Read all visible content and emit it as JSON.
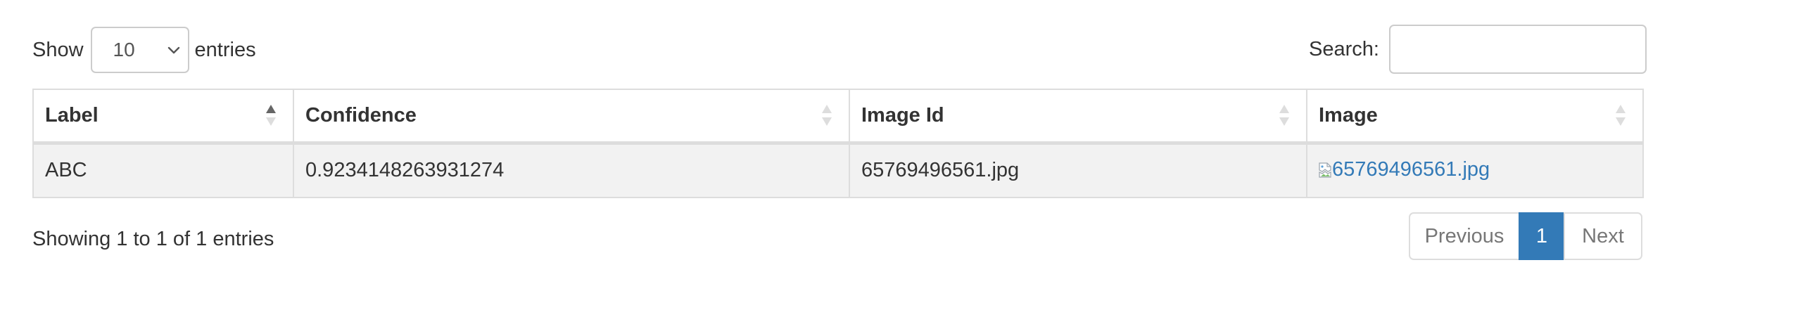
{
  "length_control": {
    "prefix": "Show",
    "selected": "10",
    "suffix": "entries"
  },
  "search": {
    "label": "Search:",
    "value": ""
  },
  "table": {
    "columns": [
      {
        "label": "Label",
        "sort": "ascending"
      },
      {
        "label": "Confidence",
        "sort": "none"
      },
      {
        "label": "Image Id",
        "sort": "none"
      },
      {
        "label": "Image",
        "sort": "none"
      }
    ],
    "rows": [
      {
        "label": "ABC",
        "confidence": "0.9234148263931274",
        "image_id": "65769496561.jpg",
        "image_alt": "65769496561.jpg"
      }
    ]
  },
  "footer": {
    "info": "Showing 1 to 1 of 1 entries",
    "previous_label": "Previous",
    "current_page": "1",
    "next_label": "Next"
  },
  "colors": {
    "link": "#337ab7",
    "active_page": "#337ab7",
    "row_background": "#f2f2f2",
    "border": "#dddddd"
  },
  "icons": {
    "sort_active": "sort-ascending-icon",
    "sort_inactive": "sort-both-icon",
    "select_arrow": "chevron-down-icon",
    "broken_image": "broken-image-icon"
  }
}
